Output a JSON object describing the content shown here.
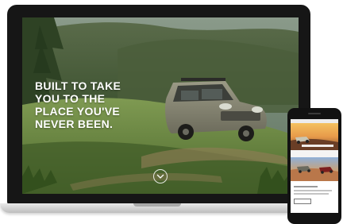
{
  "hero": {
    "headline": "BUILT TO TAKE\nYOU TO THE\nPLACE YOU'VE\nNEVER BEEN.",
    "scroll_icon": "chevron-down-icon"
  },
  "devices": {
    "laptop_icon": "laptop-mockup",
    "phone_icon": "phone-mockup"
  },
  "colors": {
    "headline": "#ffffff",
    "device_frame": "#161616",
    "laptop_base": "#d9d9d9"
  }
}
